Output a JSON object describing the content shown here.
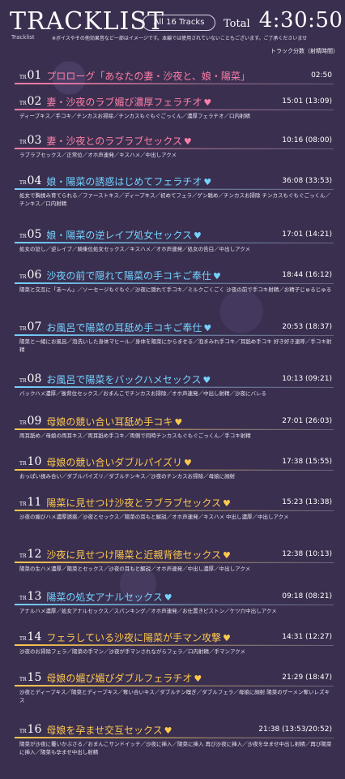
{
  "header": {
    "logo_text": "TRACKLIST",
    "logo_sub": "Tracklist",
    "all_tracks_label": "All 16 Tracks",
    "total_label": "Total",
    "total_value": "4:30:50",
    "notice": "※ボイスやその他効果音など一部はイメージです。本編では使用されていないこともございます。ご了承くださいませ",
    "legend": "トラック分数（射精時間）"
  },
  "tracks": [
    {
      "no": "01",
      "title": "プロローグ「あなたの妻・沙夜と、娘・陽菜」",
      "time": "02:50",
      "heart": "",
      "color": "#ff7fa8",
      "tags": ""
    },
    {
      "no": "02",
      "title": "妻・沙夜のラブ媚び濃厚フェラチオ",
      "time": "15:01 (13:09)",
      "heart": "♥",
      "color": "#ff7fa8",
      "tags": "ディープキス／手コキ／チンカスお掃除／チンカスもぐもぐごっくん／濃厚フェラチオ／口内射精"
    },
    {
      "no": "03",
      "title": "妻・沙夜とのラブラブセックス",
      "time": "10:16 (08:00)",
      "heart": "♥",
      "color": "#ff7fa8",
      "tags": "ラブラブセックス／正常位／オホ声連発／キスハメ／中出しアクメ"
    },
    {
      "no": "04",
      "title": "娘・陽菜の誘惑はじめてフェラチオ",
      "time": "36:08 (33:53)",
      "heart": "♥",
      "color": "#74d2ff",
      "tags": "処女で胸揉み育てられる／ファーストキス／ディープキス／初めてフェラ／ゲン眺め／チンカスお掃除 チンカスもぐもぐごっくん／チンキス／口内射精"
    },
    {
      "no": "05",
      "title": "娘・陽菜の逆レイプ処女セックス",
      "time": "17:01 (14:21)",
      "heart": "♥",
      "color": "#74d2ff",
      "tags": "処女の証し／逆レイプ／騎乗位処女セックス／キスハメ／オホ声連発／処女の告白／中出しアクメ"
    },
    {
      "no": "06",
      "title": "沙夜の前で隠れて陽菜の手コキご奉仕",
      "time": "18:44 (16:12)",
      "heart": "♥",
      "color": "#74d2ff",
      "tags": "陽菜と交互に「あ～ん」／ソーセージもぐもぐ／沙夜に隠れて手コキ／ミルクごくごく 沙夜の前で手コキ射精／お精子じゅるじゅる"
    },
    {
      "no": "07",
      "title": "お風呂で陽菜の耳舐め手コキご奉仕",
      "time": "20:53 (18:37)",
      "heart": "♥",
      "color": "#74d2ff",
      "tags": "陽菜と一緒にお風呂／泡洗いした身体マヒール／身体を陽菜にからませる／泡まみれ手コキ／耳舐め手コキ 好き好き連呼／手コキ射精"
    },
    {
      "no": "08",
      "title": "お風呂で陽菜をバックハメセックス",
      "time": "10:13 (09:21)",
      "heart": "♥",
      "color": "#74d2ff",
      "tags": "バックハメ濃厚／後背位セックス／おまんこでチンカスお掃除／オホ声連発／中出し射精／沙夜にバレる"
    },
    {
      "no": "09",
      "title": "母娘の競い合い耳舐め手コキ",
      "time": "27:01 (26:03)",
      "heart": "♥",
      "color": "#ffc94d",
      "tags": "両耳舐め／母娘の両耳キス／両耳舐め手コキ／両側で同時チンカスもぐもぐごっくん／手コキ射精"
    },
    {
      "no": "10",
      "title": "母娘の競い合いダブルパイズリ",
      "time": "17:38 (15:55)",
      "heart": "♥",
      "color": "#ffc94d",
      "tags": "おっぱい揉み合い／ダブルパイズリ／ダブルチンキス／沙夜のチンカスお掃除／母娘に顔射"
    },
    {
      "no": "11",
      "title": "陽菜に見せつけ沙夜とラブラブセックス",
      "time": "15:23 (13:38)",
      "heart": "♥",
      "color": "#ffc94d",
      "tags": "沙夜の媚びハメ濃厚誘惑／沙夜とセックス／陽菜の耳もと解説／オホ声連発／キスハメ 中出し濃厚／中出しアクメ"
    },
    {
      "no": "12",
      "title": "沙夜に見せつけ陽菜と近親背徳セックス",
      "time": "12:38 (10:13)",
      "heart": "♥",
      "color": "#ffc94d",
      "tags": "陽菜の生ハメ濃厚／陽菜とセックス／沙夜の耳もと解説／オホ声連発／中出し濃厚／中出しアクメ"
    },
    {
      "no": "13",
      "title": "陽菜の処女アナルセックス",
      "time": "09:18 (08:21)",
      "heart": "♥",
      "color": "#74d2ff",
      "tags": "アナルハメ濃厚／処女アナルセックス／スパンキング／オホ声連発／お仕置きピストン／ケツ穴中出しアクメ"
    },
    {
      "no": "14",
      "title": "フェラしている沙夜に陽菜が手マン攻撃",
      "time": "14:31 (12:27)",
      "heart": "♥",
      "color": "#ffc94d",
      "tags": "沙夜のお掃除フェラ／陽菜の手マン／沙夜が手マンされながらフェラ／口内射精／手マンアクメ"
    },
    {
      "no": "15",
      "title": "母娘の媚び媚びダブルフェラチオ",
      "time": "21:29 (18:47)",
      "heart": "♥",
      "color": "#ffc94d",
      "tags": "沙夜とディープキス／陽菜とディープキス／奪い合いキス／ダブルチン嗅ぎ／ダブルフェラ／母娘に顔射 陽菜のザーメン奪いレズキス"
    },
    {
      "no": "16",
      "title": "母娘を孕ませ交互セックス",
      "time": "21:38 (13:53/20:52)",
      "heart": "♥",
      "color": "#ffc94d",
      "tags": "陽菜が沙夜に覆いかぶさる／おまんこサンドイッチ／沙夜に挿入／陽菜に挿入 再び沙夜に挿入／沙夜を孕ませ中出し射精／再び陽菜に挿入／陽菜も孕ませ中出し射精"
    }
  ]
}
